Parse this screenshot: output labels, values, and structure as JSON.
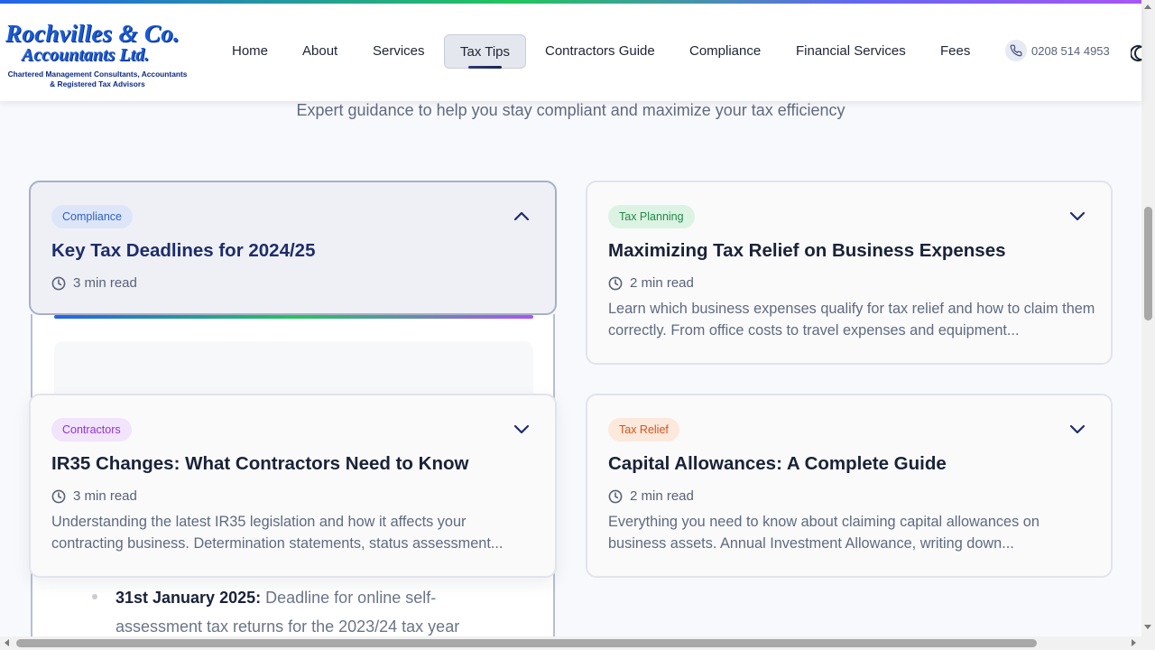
{
  "header": {
    "logo": {
      "line1": "Rochvilles & Co.",
      "line2": "Accountants Ltd.",
      "line3": "Chartered Management Consultants, Accountants & Registered Tax Advisors"
    },
    "nav": [
      "Home",
      "About",
      "Services",
      "Tax Tips",
      "Contractors Guide",
      "Compliance",
      "Financial Services",
      "Fees"
    ],
    "active_nav": "Tax Tips",
    "phone": "0208 514 4953"
  },
  "subtitle": "Expert guidance to help you stay compliant and maximize your tax efficiency",
  "cards": [
    {
      "tag": "Compliance",
      "title": "Key Tax Deadlines for 2024/25",
      "read_time": "3 min read",
      "expanded": true,
      "tag_colors": {
        "bg": "#dde6f8",
        "fg": "#2f5fc4"
      }
    },
    {
      "tag": "Tax Planning",
      "title": "Maximizing Tax Relief on Business Expenses",
      "read_time": "2 min read",
      "excerpt": "Learn which business expenses qualify for tax relief and how to claim them correctly. From office costs to travel expenses and equipment...",
      "tag_colors": {
        "bg": "#dcf3e3",
        "fg": "#1f8a46"
      }
    },
    {
      "tag": "Contractors",
      "title": "IR35 Changes: What Contractors Need to Know",
      "read_time": "3 min read",
      "excerpt": "Understanding the latest IR35 legislation and how it affects your contracting business. Determination statements, status assessment...",
      "tag_colors": {
        "bg": "#f1e4fb",
        "fg": "#9333d6"
      }
    },
    {
      "tag": "Tax Relief",
      "title": "Capital Allowances: A Complete Guide",
      "read_time": "2 min read",
      "excerpt": "Everything you need to know about claiming capital allowances on business assets. Annual Investment Allowance, writing down...",
      "tag_colors": {
        "bg": "#fde8dc",
        "fg": "#d2541a"
      }
    }
  ],
  "expanded_content": {
    "deadline_date": "31st January 2025:",
    "deadline_text": "Deadline for online self-assessment tax returns for the 2023/24 tax year"
  }
}
